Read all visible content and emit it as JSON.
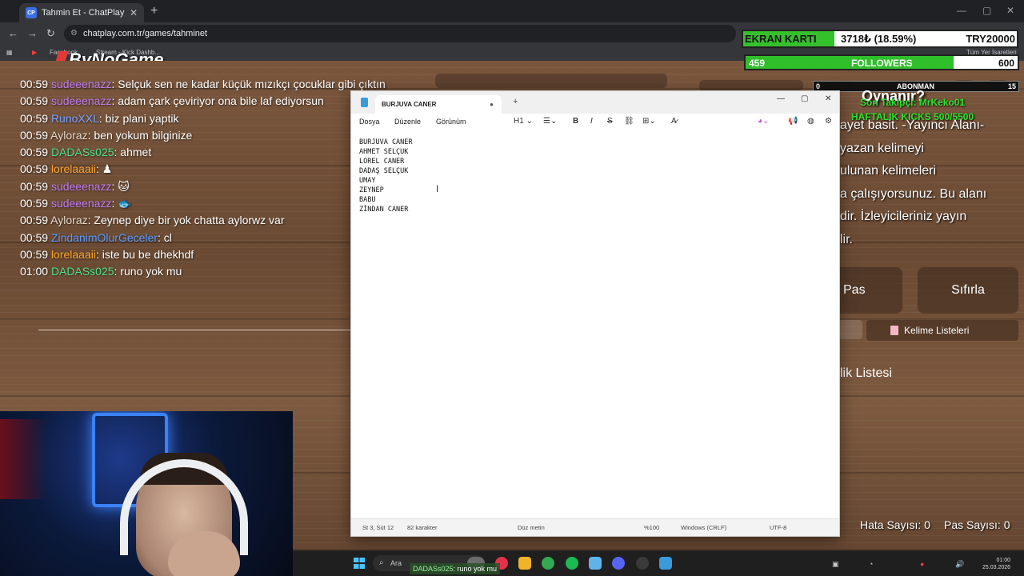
{
  "browser": {
    "tab_title": "Tahmin Et - ChatPlay",
    "tab_favicon": "CP",
    "url": "chatplay.com.tr/games/tahminet",
    "bookmarks": [
      "Facebook",
      "Stream - Kick Dashb...",
      "Tüm Yer İşaretleri"
    ]
  },
  "logo": "ByNoGame",
  "chat": [
    {
      "time": "00:59",
      "user": "sudeeenazz",
      "color": "#c07bf0",
      "text": ": Selçuk sen ne kadar küçük mızıkçı çocuklar gibi çıktın"
    },
    {
      "time": "00:59",
      "user": "sudeeenazz",
      "color": "#c07bf0",
      "text": ": adam çark çeviriyor ona bile laf ediyorsun"
    },
    {
      "time": "00:59",
      "user": "RunoXXL",
      "color": "#7aa6ff",
      "text": ": biz plani yaptik"
    },
    {
      "time": "00:59",
      "user": "Ayloraz",
      "color": "#e6d7c8",
      "text": ": ben yokum bilginize"
    },
    {
      "time": "00:59",
      "user": "DADASs025",
      "color": "#4fe08a",
      "text": ": ahmet"
    },
    {
      "time": "00:59",
      "user": "lorelaaaii",
      "color": "#ffa630",
      "text": ": ♟"
    },
    {
      "time": "00:59",
      "user": "sudeeenazz",
      "color": "#c07bf0",
      "text": ": 🐱"
    },
    {
      "time": "00:59",
      "user": "sudeeenazz",
      "color": "#c07bf0",
      "text": ": 🐟"
    },
    {
      "time": "00:59",
      "user": "Ayloraz",
      "color": "#e6d7c8",
      "text": ": Zeynep diye bir yok chatta aylorwz var"
    },
    {
      "time": "00:59",
      "user": "ZindanimOlurGeceler",
      "color": "#5b9bff",
      "text": ": cl"
    },
    {
      "time": "00:59",
      "user": "lorelaaaii",
      "color": "#ffa630",
      "text": ": iste bu be dhekhdf"
    },
    {
      "time": "01:00",
      "user": "DADASs025",
      "color": "#4fe08a",
      "text": ": runo yok mu"
    }
  ],
  "overlay": {
    "ekran_label": "EKRAN KARTI",
    "ekran_value": "3718₺ (18.59%)",
    "ekran_goal": "TRY20000",
    "ekran_progress": 0.1859,
    "followers_current": "459",
    "followers_label": "FOLLOWERS",
    "followers_goal": "600",
    "followers_progress": 0.765,
    "abonman_current": "0",
    "abonman_label": "ABONMAN",
    "abonman_goal": "15",
    "game_title": "Oynanır?",
    "son_takipci": "Son Takipçi: MrKeko01",
    "haftalik": "HAFTALIK KICKS 500/5500",
    "desc_lines": [
      "ayet basit. -Yayıncı Alanı-",
      "yazan kelimeyi",
      "ulunan kelimeleri",
      "a çalışıyorsunuz. Bu alanı",
      "dir. İzleyicileriniz yayın",
      "lir."
    ],
    "pas_button": "Pas",
    "sifirla_button": "Sıfırla",
    "kelime_listeleri": "Kelime Listeleri",
    "lik_listesi": "lik Listesi",
    "hata_sayisi": "Hata Sayısı: 0",
    "pas_sayisi": "Pas Sayısı: 0"
  },
  "notepad": {
    "tab_title": "BURJUVA CANER",
    "menu": [
      "Dosya",
      "Düzenle",
      "Görünüm"
    ],
    "heading_tool": "H1",
    "lines": [
      "BURJUVA CANER",
      "AHMET SELÇUK",
      "LOREL CANER",
      "DADAŞ SELÇUK",
      "UMAY",
      "ZEYNEP",
      "BABU",
      "ZİNDAN CANER"
    ],
    "status": {
      "position": "St 3, Süt 12",
      "chars": "82 karakter",
      "format": "Düz metin",
      "zoom": "%100",
      "line_ending": "Windows (CRLF)",
      "encoding": "UTF-8"
    }
  },
  "taskbar": {
    "search_placeholder": "Ara",
    "chat_notice_user": "DADASs025",
    "chat_notice_text": ": runo yok mu",
    "time": "01:00",
    "date": "25.03.2026"
  }
}
